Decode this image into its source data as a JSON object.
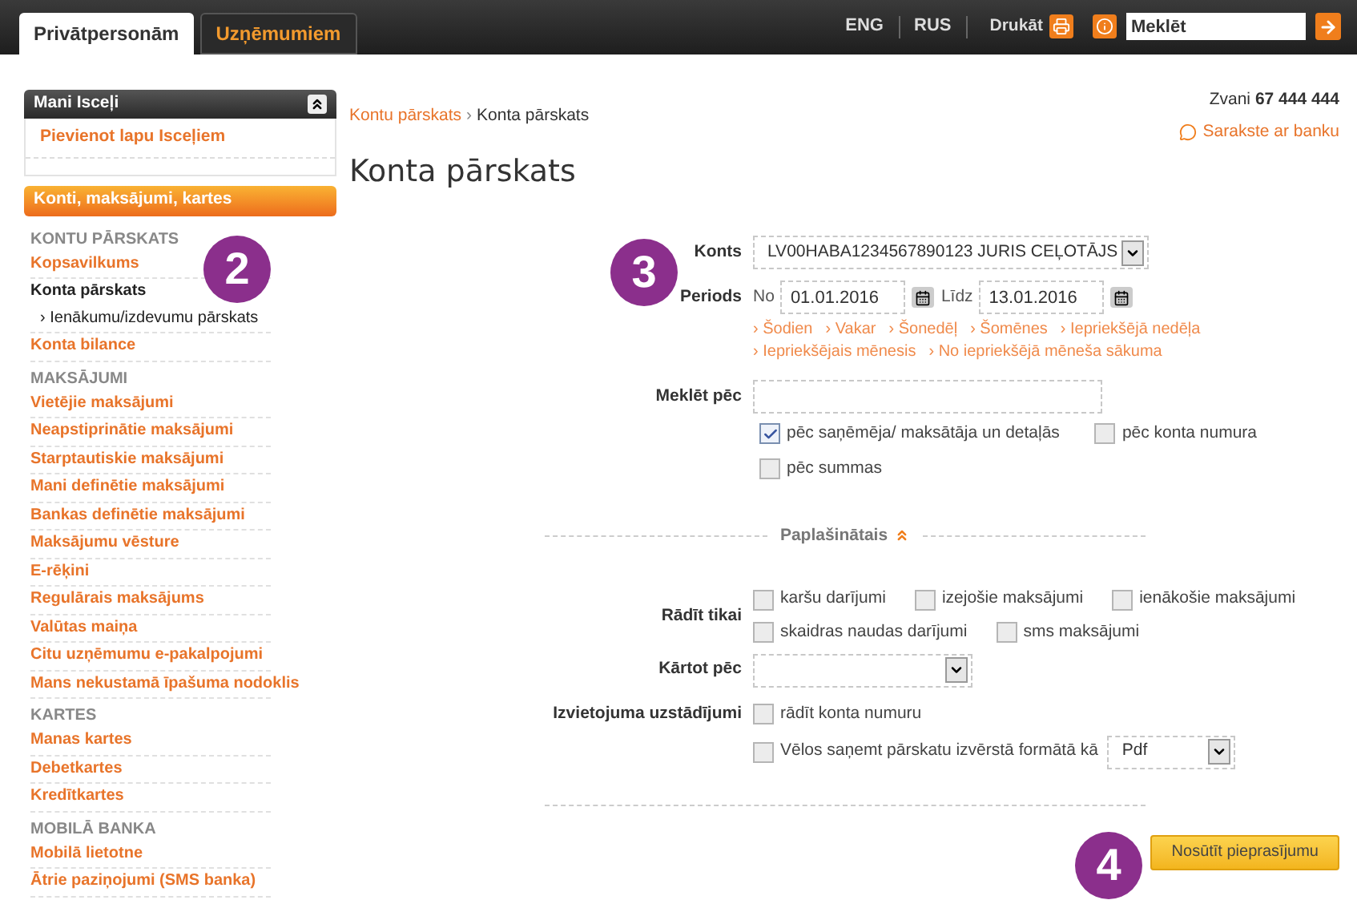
{
  "top_tabs": [
    {
      "label": "Privātpersonām",
      "selected": true
    },
    {
      "label": "Uzņēmumiem",
      "selected": false
    }
  ],
  "languages": [
    "ENG",
    "RUS"
  ],
  "print_label": "Drukāt",
  "search": {
    "placeholder": "Meklēt"
  },
  "sidebar": {
    "favorites": {
      "title": "Mani Isceļi",
      "expanded": true,
      "add_link": "Pievienot lapu Isceļiem"
    },
    "category": "Konti, maksājumi, kartes",
    "sections": [
      {
        "heading": "KONTU PĀRSKATS",
        "items": [
          {
            "label": "Kopsavilkums",
            "selected": false
          },
          {
            "label": "Konta pārskats",
            "selected": true,
            "children": [
              {
                "label": "› Ienākumu/izdevumu pārskats"
              }
            ]
          },
          {
            "label": "Konta bilance",
            "selected": false
          }
        ]
      },
      {
        "heading": "MAKSĀJUMI",
        "items": [
          {
            "label": "Vietējie maksājumi",
            "selected": false
          },
          {
            "label": "Neapstiprinātie maksājumi",
            "selected": false
          },
          {
            "label": "Starptautiskie maksājumi",
            "selected": false
          },
          {
            "label": "Mani definētie maksājumi",
            "selected": false
          },
          {
            "label": "Bankas definētie maksājumi",
            "selected": false
          },
          {
            "label": "Maksājumu vēsture",
            "selected": false
          },
          {
            "label": "E-rēķini",
            "selected": false
          },
          {
            "label": "Regulārais maksājums",
            "selected": false
          },
          {
            "label": "Valūtas maiņa",
            "selected": false
          },
          {
            "label": "Citu uzņēmumu e-pakalpojumi",
            "selected": false
          },
          {
            "label": "Mans nekustamā īpašuma nodoklis",
            "selected": false
          }
        ]
      },
      {
        "heading": "KARTES",
        "items": [
          {
            "label": "Manas kartes",
            "selected": false
          },
          {
            "label": "Debetkartes",
            "selected": false
          },
          {
            "label": "Kredītkartes",
            "selected": false
          }
        ]
      },
      {
        "heading": "MOBILĀ BANKA",
        "items": [
          {
            "label": "Mobilā lietotne",
            "selected": false
          },
          {
            "label": "Ātrie paziņojumi (SMS banka)",
            "selected": false
          }
        ]
      }
    ]
  },
  "breadcrumb": {
    "separator": "›",
    "items": [
      "Kontu pārskats",
      "Konta pārskats"
    ]
  },
  "title": "Konta pārskats",
  "contact": {
    "call_label": "Zvani",
    "phone": "67 444 444",
    "chat_link": "Sarakste ar banku"
  },
  "form": {
    "account": {
      "label": "Konts",
      "value": "LV00HABA1234567890123 JURIS CEĻOTĀJS"
    },
    "period": {
      "label": "Periods",
      "from_label": "No",
      "from": "01.01.2016",
      "to_label": "Līdz",
      "to": "13.01.2016",
      "quick_links": [
        "› Šodien",
        "› Vakar",
        "› Šonedēļ",
        "› Šomēnes",
        "› Iepriekšējā nedēļa",
        "› Iepriekšējais mēnesis",
        "› No iepriekšējā mēneša sākuma"
      ]
    },
    "search_by": {
      "label": "Meklēt pēc",
      "options": [
        {
          "label": "pēc saņēmēja/ maksātāja un detaļās",
          "checked": true
        },
        {
          "label": "pēc konta numura",
          "checked": false
        },
        {
          "label": "pēc summas",
          "checked": false
        }
      ]
    },
    "advanced": {
      "label": "Paplašinātais",
      "expanded": true
    },
    "show_only": {
      "label": "Rādīt tikai",
      "options": [
        {
          "label": "karšu darījumi",
          "checked": false
        },
        {
          "label": "izejošie maksājumi",
          "checked": false
        },
        {
          "label": "ienākošie maksājumi",
          "checked": false
        },
        {
          "label": "skaidras naudas darījumi",
          "checked": false
        },
        {
          "label": "sms maksājumi",
          "checked": false
        }
      ]
    },
    "sort_by": {
      "label": "Kārtot pēc"
    },
    "layout": {
      "label": "Izvietojuma uzstādījumi",
      "show_account": {
        "label": "rādīt konta numuru",
        "checked": false
      },
      "extended": {
        "label": "Vēlos saņemt pārskatu izvērstā formātā kā",
        "checked": false,
        "format": "Pdf"
      }
    },
    "submit": "Nosūtīt pieprasījumu"
  },
  "step_badges": [
    "2",
    "3",
    "4"
  ]
}
